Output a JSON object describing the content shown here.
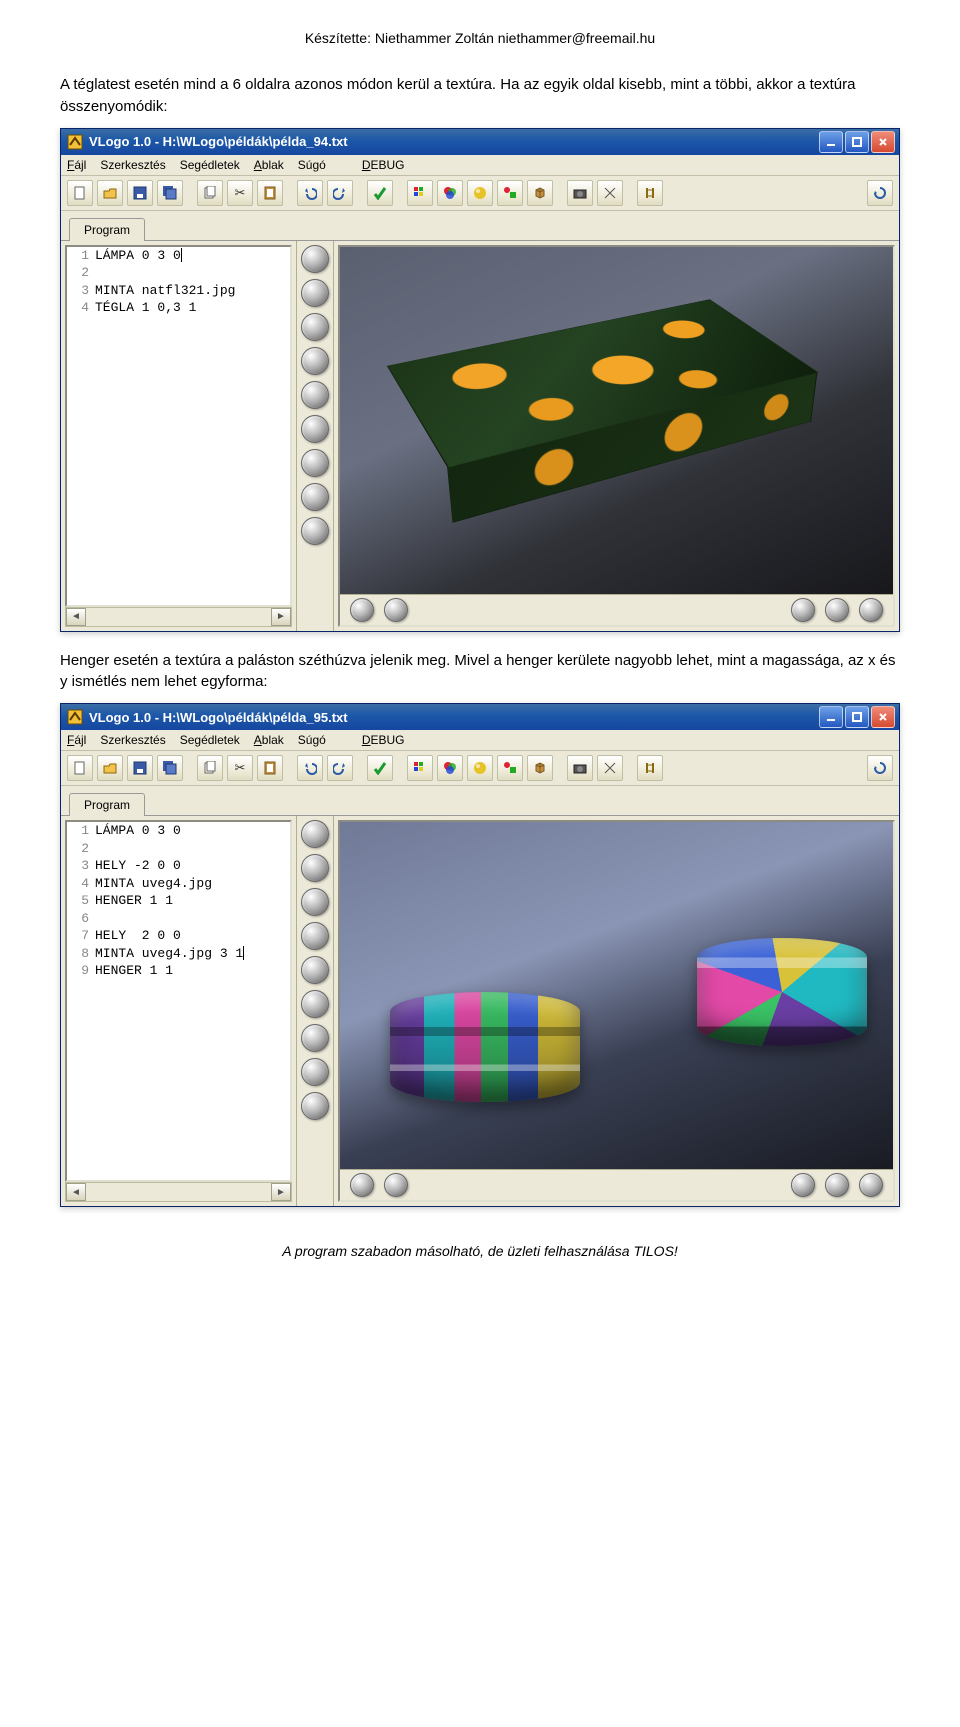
{
  "header_line": "Készítette: Niethammer Zoltán  niethammer@freemail.hu",
  "para1": "A téglatest esetén mind a 6 oldalra azonos módon kerül a textúra. Ha az egyik oldal kisebb, mint a többi, akkor a textúra összenyomódik:",
  "para2": "Henger esetén a textúra a paláston széthúzva jelenik meg. Mivel a henger kerülete nagyobb lehet, mint a magassága, az x és y ismétlés nem lehet egyforma:",
  "footer_line": "A program szabadon másolható, de üzleti felhasználása TILOS!",
  "win1": {
    "title": "VLogo 1.0 - H:\\WLogo\\példák\\példa_94.txt",
    "menus": [
      "Fájl",
      "Szerkesztés",
      "Segédletek",
      "Ablak",
      "Súgó",
      "DEBUG"
    ],
    "tab": "Program",
    "code": [
      "LÁMPA 0 3 0",
      "",
      "MINTA natfl321.jpg",
      "TÉGLA 1 0,3 1"
    ]
  },
  "win2": {
    "title": "VLogo 1.0 - H:\\WLogo\\példák\\példa_95.txt",
    "menus": [
      "Fájl",
      "Szerkesztés",
      "Segédletek",
      "Ablak",
      "Súgó",
      "DEBUG"
    ],
    "tab": "Program",
    "code": [
      "LÁMPA 0 3 0",
      "",
      "HELY -2 0 0",
      "MINTA uveg4.jpg",
      "HENGER 1 1",
      "",
      "HELY  2 0 0",
      "MINTA uveg4.jpg 3 1",
      "HENGER 1 1"
    ]
  },
  "toolbar_icons": [
    "new",
    "open",
    "save",
    "save-all",
    "",
    "copy",
    "cut",
    "paste",
    "",
    "undo",
    "redo",
    "",
    "check",
    "",
    "palette",
    "colors",
    "sphere-yellow",
    "primitives",
    "cube",
    "",
    "camera",
    "lines",
    "",
    "mirror",
    "",
    "cycle"
  ],
  "side_orb_count": 9,
  "bottom_orb_count": 5
}
